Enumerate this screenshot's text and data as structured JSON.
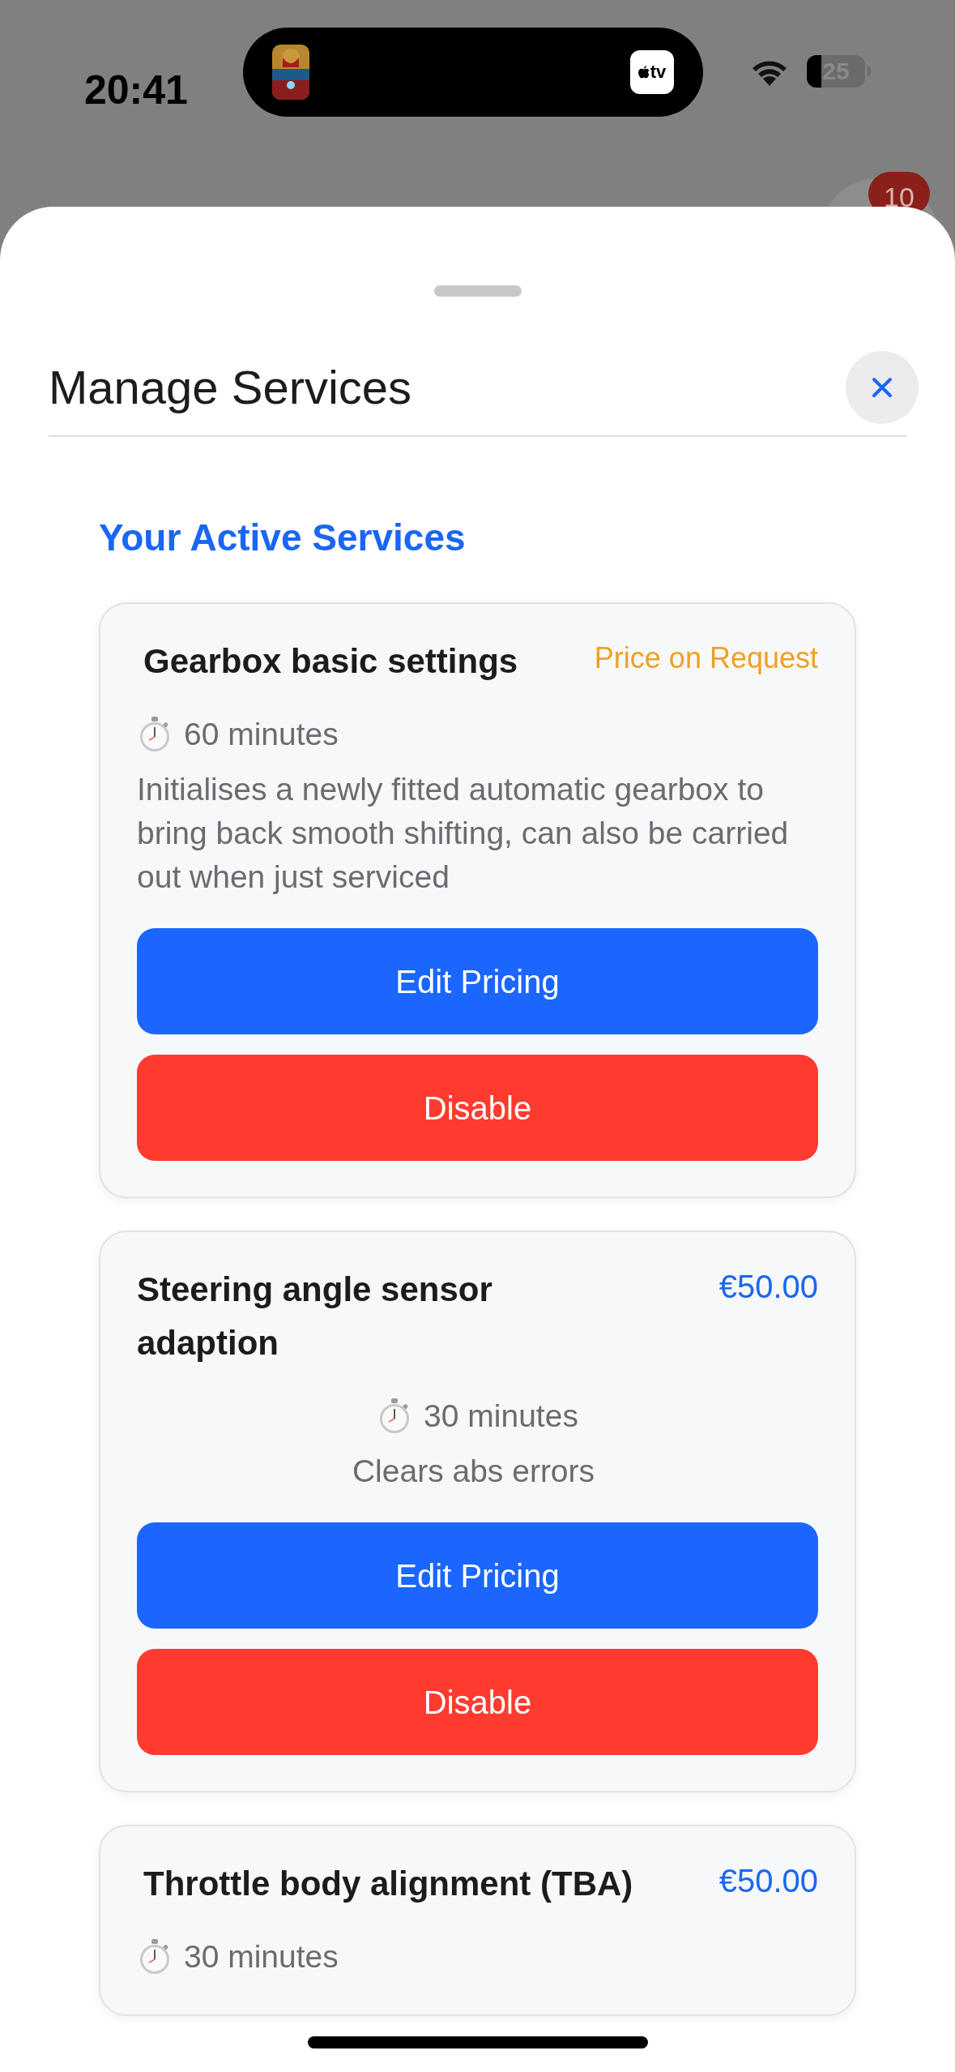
{
  "status_bar": {
    "time": "20:41",
    "island_app_label": "tv",
    "battery": "25"
  },
  "badge": "10",
  "sheet": {
    "title": "Manage Services",
    "section_title": "Your Active Services",
    "services": [
      {
        "title": "Gearbox basic settings",
        "price": "Price on Request",
        "kind": "on_request",
        "duration": "60 minutes",
        "description": "Initialises a newly fitted automatic gearbox to bring back smooth shifting, can also be carried out when just serviced",
        "centered": false,
        "buttons": [
          {
            "label": "Edit Pricing",
            "kind": "primary"
          },
          {
            "label": "Disable",
            "kind": "danger"
          }
        ]
      },
      {
        "title": "Steering angle sensor adaption",
        "price": "€50.00",
        "kind": "amount",
        "duration": "30 minutes",
        "description": "Clears abs errors",
        "centered": true,
        "buttons": [
          {
            "label": "Edit Pricing",
            "kind": "primary"
          },
          {
            "label": "Disable",
            "kind": "danger"
          }
        ]
      },
      {
        "title": "Throttle body alignment (TBA)",
        "price": "€50.00",
        "kind": "amount",
        "duration": "30 minutes",
        "centered": false
      }
    ]
  }
}
